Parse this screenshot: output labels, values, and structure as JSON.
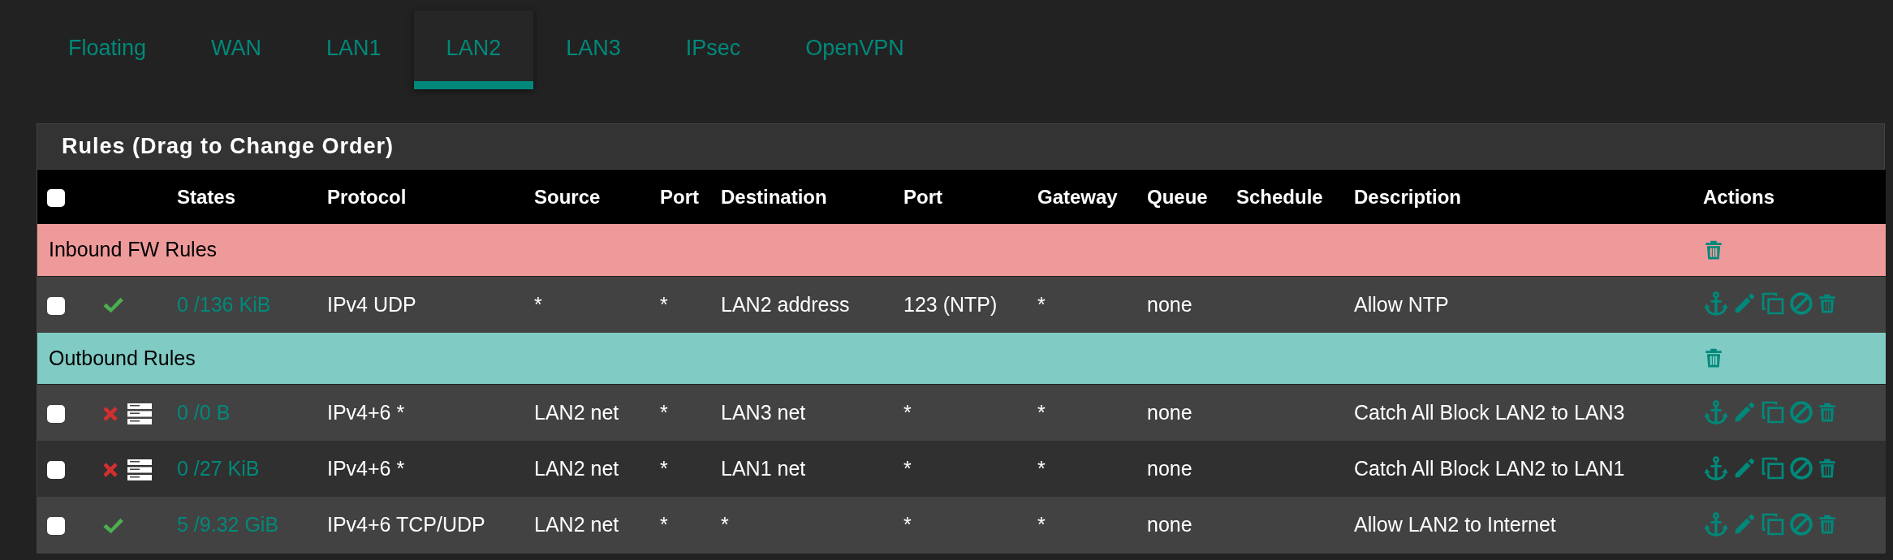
{
  "tabs": [
    {
      "label": "Floating",
      "selected": false
    },
    {
      "label": "WAN",
      "selected": false
    },
    {
      "label": "LAN1",
      "selected": false
    },
    {
      "label": "LAN2",
      "selected": true
    },
    {
      "label": "LAN3",
      "selected": false
    },
    {
      "label": "IPsec",
      "selected": false
    },
    {
      "label": "OpenVPN",
      "selected": false
    }
  ],
  "panel": {
    "title": "Rules (Drag to Change Order)",
    "header_checkbox": {
      "checked": false
    },
    "columns": [
      "States",
      "Protocol",
      "Source",
      "Port",
      "Destination",
      "Port",
      "Gateway",
      "Queue",
      "Schedule",
      "Description",
      "Actions"
    ],
    "sections": [
      {
        "name": "Inbound FW Rules",
        "color": "#ee9a9b",
        "rules": [
          {
            "checked": false,
            "kind": "pass",
            "logged": false,
            "states": "0 /136 KiB",
            "protocol": "IPv4 UDP",
            "source": "*",
            "source_port": "*",
            "destination": "LAN2 address",
            "destination_port": "123 (NTP)",
            "gateway": "*",
            "queue": "none",
            "description": "Allow NTP"
          }
        ]
      },
      {
        "name": "Outbound Rules",
        "color": "#80cbc4",
        "rules": [
          {
            "checked": false,
            "kind": "block",
            "logged": true,
            "states": "0 /0 B",
            "protocol": "IPv4+6 *",
            "source": "LAN2 net",
            "source_port": "*",
            "destination": "LAN3 net",
            "destination_port": "*",
            "gateway": "*",
            "queue": "none",
            "description": "Catch All Block LAN2 to LAN3"
          },
          {
            "checked": false,
            "kind": "block",
            "logged": true,
            "states": "0 /27 KiB",
            "protocol": "IPv4+6 *",
            "source": "LAN2 net",
            "source_port": "*",
            "destination": "LAN1 net",
            "destination_port": "*",
            "gateway": "*",
            "queue": "none",
            "description": "Catch All Block LAN2 to LAN1"
          },
          {
            "checked": false,
            "kind": "pass",
            "logged": false,
            "states": "5 /9.32 GiB",
            "protocol": "IPv4+6 TCP/UDP",
            "source": "LAN2 net",
            "source_port": "*",
            "destination": "*",
            "destination_port": "*",
            "gateway": "*",
            "queue": "none",
            "description": "Allow LAN2 to Internet"
          }
        ]
      }
    ]
  }
}
